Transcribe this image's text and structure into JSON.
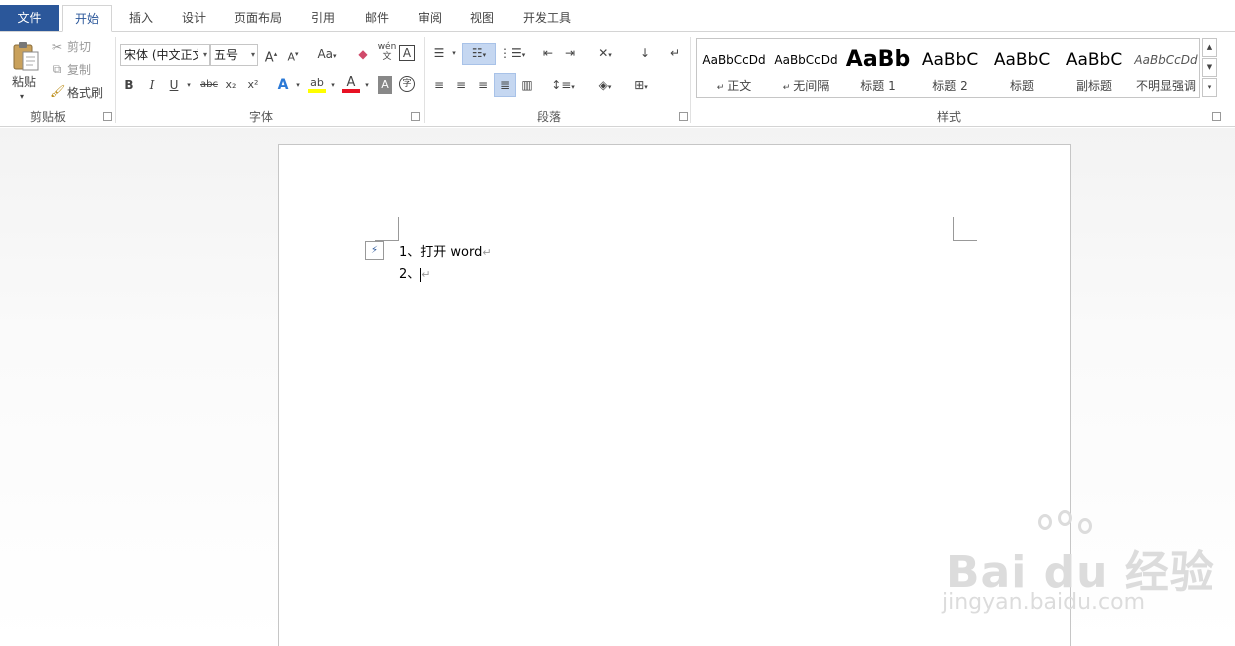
{
  "tabs": {
    "file": "文件",
    "home": "开始",
    "insert": "插入",
    "design": "设计",
    "layout": "页面布局",
    "references": "引用",
    "mailings": "邮件",
    "review": "审阅",
    "view": "视图",
    "developer": "开发工具"
  },
  "clipboard": {
    "paste": "粘贴",
    "cut": "剪切",
    "copy": "复制",
    "format_painter": "格式刷",
    "label": "剪贴板"
  },
  "font": {
    "name": "宋体 (中文正文",
    "size": "五号",
    "grow": "A",
    "shrink": "A",
    "change_case": "Aa",
    "bold": "B",
    "italic": "I",
    "underline": "U",
    "strike": "abc",
    "subscript": "x₂",
    "superscript": "x²",
    "text_effects": "A",
    "highlight": "ab",
    "font_color": "A",
    "char_shading": "A",
    "enclose": "字",
    "phonetic": "wén",
    "border": "A",
    "label": "字体",
    "highlight_color": "#ffff00",
    "font_color_value": "#e81123"
  },
  "paragraph": {
    "label": "段落"
  },
  "styles": {
    "label": "样式",
    "items": [
      {
        "preview": "AaBbCcDd",
        "name": "正文"
      },
      {
        "preview": "AaBbCcDd",
        "name": "无间隔"
      },
      {
        "preview": "AaBb",
        "name": "标题 1"
      },
      {
        "preview": "AaBbC",
        "name": "标题 2"
      },
      {
        "preview": "AaBbC",
        "name": "标题"
      },
      {
        "preview": "AaBbC",
        "name": "副标题"
      },
      {
        "preview": "AaBbCcDd",
        "name": "不明显强调"
      }
    ]
  },
  "document": {
    "line1": "1、打开 word",
    "line2_prefix": "2、"
  },
  "watermark": {
    "brand": "Bai du 经验",
    "url": "jingyan.baidu.com"
  },
  "colors": {
    "accent": "#2b579a",
    "selected_button": "#c5d7f1"
  }
}
